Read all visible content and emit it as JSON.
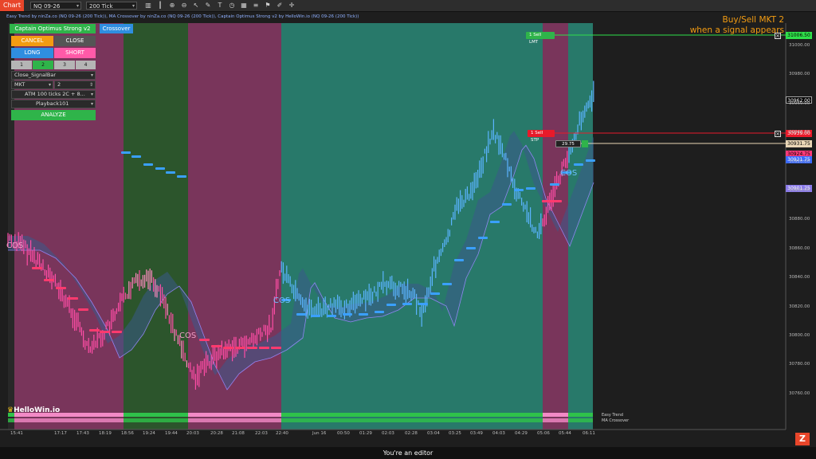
{
  "toolbar": {
    "tab_label": "Chart",
    "instrument": "NQ 09-26",
    "timeframe": "200 Tick"
  },
  "indicator_line": "Easy Trend by ninZa.co (NQ 09-26 (200 Tick)), MA Crossover by ninZa.co (NQ 09-26 (200 Tick)), Captain Optimus Strong v2 by HelloWin.io (NQ 09-26 (200 Tick))",
  "panel": {
    "title": "Captain Optimus Strong v2",
    "crossover_btn": "Crossover",
    "cancel": "CANCEL",
    "close": "CLOSE",
    "long": "LONG",
    "short": "SHORT",
    "qty": [
      "1",
      "2",
      "3",
      "4"
    ],
    "exit_mode": "Close_SignalBar",
    "order_type": "MKT",
    "order_qty": "2",
    "atm": "ATM 100 ticks 2C + 8...",
    "account": "Playback101",
    "analyze": "ANALYZE"
  },
  "headline": {
    "line1": "Buy/Sell MKT 2",
    "line2": "when a signal appears"
  },
  "orders": {
    "lmt_label": "1  Sell LMT",
    "stp_label": "1  Sell STP",
    "pnl": "29.75"
  },
  "price_tags": {
    "lmt": "31006.50",
    "last": "30962.00",
    "stp": "30939.00",
    "current": "30931.75",
    "entry": "30924.75",
    "band": "30921.75",
    "ma": "30901.25"
  },
  "y_axis": [
    "31000.00",
    "30980.00",
    "30960.00",
    "30940.00",
    "30920.00",
    "30900.00",
    "30880.00",
    "30860.00",
    "30840.00",
    "30820.00",
    "30800.00",
    "30780.00",
    "30760.00"
  ],
  "x_axis": [
    "15:41",
    "17:17",
    "17:43",
    "18:19",
    "18:56",
    "19:24",
    "19:44",
    "20:03",
    "20:28",
    "21:08",
    "22:03",
    "22:40",
    "Jun 16",
    "00:50",
    "01:29",
    "02:03",
    "02:28",
    "03:04",
    "03:25",
    "03:49",
    "04:03",
    "04:29",
    "05:06",
    "05:44",
    "06:11"
  ],
  "signals": [
    "COS",
    "COS",
    "COS",
    "COS"
  ],
  "legend": {
    "trend": "Easy Trend",
    "cross": "MA Crossover"
  },
  "brand": "HelloWin.io",
  "status_text": "You're an editor",
  "colors": {
    "accent": "#e8462a",
    "bull_zone": "#2a8a78",
    "bear_zone": "#8a3a66",
    "green_zone": "#2f5f2f",
    "buy_signal": "#3aa0ff",
    "sell_signal": "#ff3a7a"
  },
  "icons": [
    "bar-chart-icon",
    "candle-icon",
    "zoom-in-icon",
    "zoom-out-icon",
    "cursor-icon",
    "pencil-icon",
    "text-icon",
    "clock-icon",
    "grid-icon",
    "properties-icon",
    "alert-icon",
    "draw-icon",
    "crosshair-icon",
    "z-logo-icon"
  ]
}
